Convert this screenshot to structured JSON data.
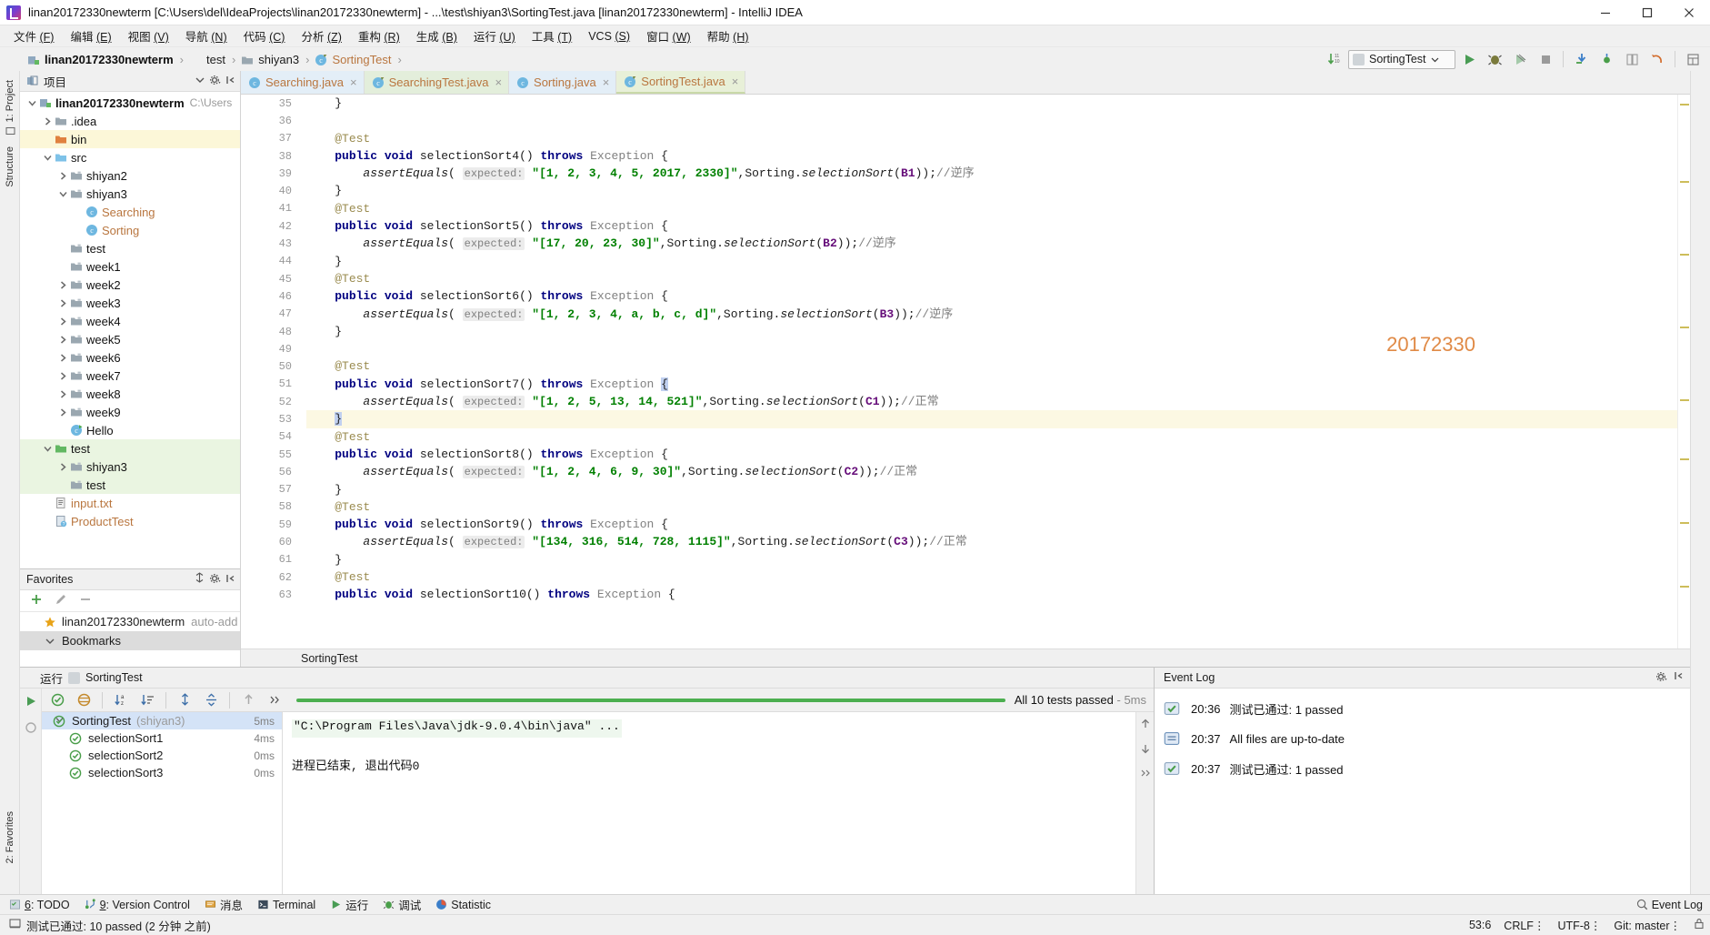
{
  "window": {
    "title": "linan20172330newterm [C:\\Users\\del\\IdeaProjects\\linan20172330newterm] - ...\\test\\shiyan3\\SortingTest.java [linan20172330newterm] - IntelliJ IDEA",
    "minimize_label": "minimize-icon",
    "maximize_label": "maximize-icon",
    "close_label": "close-icon"
  },
  "menubar": {
    "items": [
      {
        "label": "文件 (F)"
      },
      {
        "label": "编辑 (E)"
      },
      {
        "label": "视图 (V)"
      },
      {
        "label": "导航 (N)"
      },
      {
        "label": "代码 (C)"
      },
      {
        "label": "分析 (Z)"
      },
      {
        "label": "重构 (R)"
      },
      {
        "label": "生成 (B)"
      },
      {
        "label": "运行 (U)"
      },
      {
        "label": "工具 (T)"
      },
      {
        "label": "VCS (S)"
      },
      {
        "label": "窗口 (W)"
      },
      {
        "label": "帮助 (H)"
      }
    ]
  },
  "navbar": {
    "breadcrumbs": [
      {
        "label": "linan20172330newterm",
        "icon": "module-icon",
        "style": "bold"
      },
      {
        "label": "test",
        "icon": "source-folder-icon",
        "style": "plain"
      },
      {
        "label": "shiyan3",
        "icon": "folder-icon",
        "style": "plain"
      },
      {
        "label": "SortingTest",
        "icon": "class-test-icon",
        "style": "orange"
      }
    ],
    "run_config": "SortingTest",
    "buttons": [
      {
        "name": "sort-lines-icon"
      },
      {
        "name": "run-icon"
      },
      {
        "name": "debug-icon"
      },
      {
        "name": "run-with-coverage-icon"
      },
      {
        "name": "stop-icon"
      },
      {
        "name": "update-project-icon"
      },
      {
        "name": "commit-icon"
      },
      {
        "name": "compare-icon"
      },
      {
        "name": "rollback-icon"
      },
      {
        "name": "structure-icon"
      }
    ]
  },
  "left_rail": [
    {
      "label": "1: Project",
      "icon": "project-icon"
    },
    {
      "label": "Structure",
      "icon": "structure-icon"
    }
  ],
  "left_rail_bottom": [
    {
      "label": "2: Favorites",
      "icon": "favorites-icon"
    }
  ],
  "project_panel": {
    "header_title": "项目",
    "header_icons": [
      "collapse-icon",
      "gear-icon"
    ],
    "tree": [
      {
        "depth": 0,
        "label": "linan20172330newterm",
        "sub": "C:\\Users",
        "icon": "module-icon",
        "arrow": "down",
        "bold": true,
        "hl": ""
      },
      {
        "depth": 1,
        "label": ".idea",
        "icon": "folder-icon",
        "arrow": "right",
        "bold": false,
        "hl": ""
      },
      {
        "depth": 1,
        "label": "bin",
        "icon": "folder-orange-icon",
        "arrow": "",
        "bold": false,
        "hl": "yellow"
      },
      {
        "depth": 1,
        "label": "src",
        "icon": "folder-blue-icon",
        "arrow": "down",
        "bold": false,
        "hl": ""
      },
      {
        "depth": 2,
        "label": "shiyan2",
        "icon": "package-icon",
        "arrow": "right",
        "bold": false,
        "hl": ""
      },
      {
        "depth": 2,
        "label": "shiyan3",
        "icon": "package-icon",
        "arrow": "down",
        "bold": false,
        "hl": ""
      },
      {
        "depth": 3,
        "label": "Searching",
        "icon": "class-icon",
        "arrow": "",
        "bold": false,
        "hl": "",
        "orange": true
      },
      {
        "depth": 3,
        "label": "Sorting",
        "icon": "class-icon",
        "arrow": "",
        "bold": false,
        "hl": "",
        "orange": true
      },
      {
        "depth": 2,
        "label": "test",
        "icon": "package-icon",
        "arrow": "",
        "bold": false,
        "hl": ""
      },
      {
        "depth": 2,
        "label": "week1",
        "icon": "package-icon",
        "arrow": "",
        "bold": false,
        "hl": ""
      },
      {
        "depth": 2,
        "label": "week2",
        "icon": "package-icon",
        "arrow": "right",
        "bold": false,
        "hl": ""
      },
      {
        "depth": 2,
        "label": "week3",
        "icon": "package-icon",
        "arrow": "right",
        "bold": false,
        "hl": ""
      },
      {
        "depth": 2,
        "label": "week4",
        "icon": "package-icon",
        "arrow": "right",
        "bold": false,
        "hl": ""
      },
      {
        "depth": 2,
        "label": "week5",
        "icon": "package-icon",
        "arrow": "right",
        "bold": false,
        "hl": ""
      },
      {
        "depth": 2,
        "label": "week6",
        "icon": "package-icon",
        "arrow": "right",
        "bold": false,
        "hl": ""
      },
      {
        "depth": 2,
        "label": "week7",
        "icon": "package-icon",
        "arrow": "right",
        "bold": false,
        "hl": ""
      },
      {
        "depth": 2,
        "label": "week8",
        "icon": "package-icon",
        "arrow": "right",
        "bold": false,
        "hl": ""
      },
      {
        "depth": 2,
        "label": "week9",
        "icon": "package-icon",
        "arrow": "right",
        "bold": false,
        "hl": ""
      },
      {
        "depth": 2,
        "label": "Hello",
        "icon": "class-run-icon",
        "arrow": "",
        "bold": false,
        "hl": ""
      },
      {
        "depth": 1,
        "label": "test",
        "icon": "folder-green-icon",
        "arrow": "down",
        "bold": false,
        "hl": "green"
      },
      {
        "depth": 2,
        "label": "shiyan3",
        "icon": "package-icon",
        "arrow": "right",
        "bold": false,
        "hl": "green"
      },
      {
        "depth": 2,
        "label": "test",
        "icon": "package-icon",
        "arrow": "",
        "bold": false,
        "hl": "green"
      },
      {
        "depth": 1,
        "label": "input.txt",
        "icon": "text-file-icon",
        "arrow": "",
        "bold": false,
        "hl": "",
        "orange": true
      },
      {
        "depth": 1,
        "label": "ProductTest",
        "icon": "file-icon",
        "arrow": "",
        "bold": false,
        "hl": "",
        "orange": true
      }
    ]
  },
  "favorites_panel": {
    "title": "Favorites",
    "toolbar_icons": [
      "add-icon",
      "edit-icon",
      "remove-icon"
    ],
    "items": [
      {
        "label": "linan20172330newterm",
        "sub": "auto-add",
        "icon": "star-icon",
        "style": "sel"
      },
      {
        "label": "Bookmarks",
        "sub": "",
        "icon": "chevron-down-icon",
        "style": "grey"
      }
    ]
  },
  "editor": {
    "tabs": [
      {
        "label": "Searching.java",
        "icon": "class-icon",
        "active": false,
        "theme": "t1"
      },
      {
        "label": "SearchingTest.java",
        "icon": "class-test-icon",
        "active": false,
        "theme": "t2"
      },
      {
        "label": "Sorting.java",
        "icon": "class-icon",
        "active": false,
        "theme": "t3"
      },
      {
        "label": "SortingTest.java",
        "icon": "class-test-icon",
        "active": true,
        "theme": "t4"
      }
    ],
    "watermark": "20172330",
    "breadcrumb": "SortingTest",
    "first_line_number": 35,
    "lines": [
      {
        "n": 35,
        "html": "    }",
        "gutter_run": false,
        "fold": true,
        "hl": false
      },
      {
        "n": 36,
        "html": "",
        "gutter_run": false,
        "fold": false,
        "hl": false
      },
      {
        "n": 37,
        "html": "    <span class='ann'>@Test</span>",
        "gutter_run": false,
        "fold": false,
        "hl": false
      },
      {
        "n": 38,
        "html": "    <span class='kw'>public void</span> selectionSort4() <span class='kw'>throws</span> <span class='typ'>Exception</span> {",
        "gutter_run": true,
        "fold": true,
        "hl": false
      },
      {
        "n": 39,
        "html": "        <span class='ital'>assertEquals</span>( <span class='hint'>expected:</span> <span class='str'>\"[1, 2, 3, 4, 5, 2017, 2330]\"</span>,Sorting.<span class='ital'>selectionSort</span>(<span class='fld'>B1</span>));<span class='cmt'>//逆序</span>",
        "gutter_run": false,
        "fold": false,
        "hl": false
      },
      {
        "n": 40,
        "html": "    }",
        "gutter_run": false,
        "fold": true,
        "hl": false
      },
      {
        "n": 41,
        "html": "    <span class='ann'>@Test</span>",
        "gutter_run": false,
        "fold": false,
        "hl": false
      },
      {
        "n": 42,
        "html": "    <span class='kw'>public void</span> selectionSort5() <span class='kw'>throws</span> <span class='typ'>Exception</span> {",
        "gutter_run": true,
        "fold": true,
        "hl": false
      },
      {
        "n": 43,
        "html": "        <span class='ital'>assertEquals</span>( <span class='hint'>expected:</span> <span class='str'>\"[17, 20, 23, 30]\"</span>,Sorting.<span class='ital'>selectionSort</span>(<span class='fld'>B2</span>));<span class='cmt'>//逆序</span>",
        "gutter_run": false,
        "fold": false,
        "hl": false
      },
      {
        "n": 44,
        "html": "    }",
        "gutter_run": false,
        "fold": true,
        "hl": false
      },
      {
        "n": 45,
        "html": "    <span class='ann'>@Test</span>",
        "gutter_run": false,
        "fold": false,
        "hl": false
      },
      {
        "n": 46,
        "html": "    <span class='kw'>public void</span> selectionSort6() <span class='kw'>throws</span> <span class='typ'>Exception</span> {",
        "gutter_run": true,
        "fold": true,
        "hl": false
      },
      {
        "n": 47,
        "html": "        <span class='ital'>assertEquals</span>( <span class='hint'>expected:</span> <span class='str'>\"[1, 2, 3, 4, a, b, c, d]\"</span>,Sorting.<span class='ital'>selectionSort</span>(<span class='fld'>B3</span>));<span class='cmt'>//逆序</span>",
        "gutter_run": false,
        "fold": false,
        "hl": false
      },
      {
        "n": 48,
        "html": "    }",
        "gutter_run": false,
        "fold": true,
        "hl": false
      },
      {
        "n": 49,
        "html": "",
        "gutter_run": false,
        "fold": false,
        "hl": false
      },
      {
        "n": 50,
        "html": "    <span class='ann'>@Test</span>",
        "gutter_run": false,
        "fold": false,
        "hl": false
      },
      {
        "n": 51,
        "html": "    <span class='kw'>public void</span> selectionSort7() <span class='kw'>throws</span> <span class='typ'>Exception</span> <span class='sel'>{</span>",
        "gutter_run": true,
        "fold": true,
        "hl": false
      },
      {
        "n": 52,
        "html": "        <span class='ital'>assertEquals</span>( <span class='hint'>expected:</span> <span class='str'>\"[1, 2, 5, 13, 14, 521]\"</span>,Sorting.<span class='ital'>selectionSort</span>(<span class='fld'>C1</span>));<span class='cmt'>//正常</span>",
        "gutter_run": false,
        "fold": false,
        "hl": false
      },
      {
        "n": 53,
        "html": "    <span class='sel'>}</span>",
        "gutter_run": false,
        "fold": true,
        "hl": true
      },
      {
        "n": 54,
        "html": "    <span class='ann'>@Test</span>",
        "gutter_run": false,
        "fold": false,
        "hl": false
      },
      {
        "n": 55,
        "html": "    <span class='kw'>public void</span> selectionSort8() <span class='kw'>throws</span> <span class='typ'>Exception</span> {",
        "gutter_run": true,
        "fold": true,
        "hl": false
      },
      {
        "n": 56,
        "html": "        <span class='ital'>assertEquals</span>( <span class='hint'>expected:</span> <span class='str'>\"[1, 2, 4, 6, 9, 30]\"</span>,Sorting.<span class='ital'>selectionSort</span>(<span class='fld'>C2</span>));<span class='cmt'>//正常</span>",
        "gutter_run": false,
        "fold": false,
        "hl": false
      },
      {
        "n": 57,
        "html": "    }",
        "gutter_run": false,
        "fold": true,
        "hl": false
      },
      {
        "n": 58,
        "html": "    <span class='ann'>@Test</span>",
        "gutter_run": false,
        "fold": false,
        "hl": false
      },
      {
        "n": 59,
        "html": "    <span class='kw'>public void</span> selectionSort9() <span class='kw'>throws</span> <span class='typ'>Exception</span> {",
        "gutter_run": true,
        "fold": true,
        "hl": false
      },
      {
        "n": 60,
        "html": "        <span class='ital'>assertEquals</span>( <span class='hint'>expected:</span> <span class='str'>\"[134, 316, 514, 728, 1115]\"</span>,Sorting.<span class='ital'>selectionSort</span>(<span class='fld'>C3</span>));<span class='cmt'>//正常</span>",
        "gutter_run": false,
        "fold": false,
        "hl": false
      },
      {
        "n": 61,
        "html": "    }",
        "gutter_run": false,
        "fold": true,
        "hl": false
      },
      {
        "n": 62,
        "html": "    <span class='ann'>@Test</span>",
        "gutter_run": false,
        "fold": false,
        "hl": false
      },
      {
        "n": 63,
        "html": "    <span class='kw'>public void</span> selectionSort10() <span class='kw'>throws</span> <span class='typ'>Exception</span> {",
        "gutter_run": true,
        "fold": true,
        "hl": false
      }
    ]
  },
  "run_panel": {
    "header_label": "运行",
    "header_config": "SortingTest",
    "toolbar_icons": [
      "rerun-icon",
      "show-passed-icon",
      "show-ignored-icon",
      "sort-alpha-icon",
      "sort-duration-icon",
      "expand-all-icon",
      "collapse-all-icon",
      "prev-icon",
      "more-icon"
    ],
    "progress_text": "All 10 tests passed",
    "progress_time": "- 5ms",
    "progress_percent": 100,
    "tests": [
      {
        "label": "SortingTest",
        "sub": "(shiyan3)",
        "time": "5ms",
        "depth": 0,
        "icon": "test-passed-icon",
        "selected": true
      },
      {
        "label": "selectionSort1",
        "sub": "",
        "time": "4ms",
        "depth": 1,
        "icon": "test-passed-icon",
        "selected": false
      },
      {
        "label": "selectionSort2",
        "sub": "",
        "time": "0ms",
        "depth": 1,
        "icon": "test-passed-icon",
        "selected": false
      },
      {
        "label": "selectionSort3",
        "sub": "",
        "time": "0ms",
        "depth": 1,
        "icon": "test-passed-icon",
        "selected": false
      }
    ],
    "console_lines": [
      {
        "text": "\"C:\\Program Files\\Java\\jdk-9.0.4\\bin\\java\" ...",
        "style": "cmd"
      },
      {
        "text": "",
        "style": "plain"
      },
      {
        "text": "进程已结束, 退出代码0",
        "style": "plain"
      }
    ]
  },
  "event_log": {
    "title": "Event Log",
    "header_icons": [
      "gear-icon",
      "collapse-icon"
    ],
    "entries": [
      {
        "time": "20:36",
        "text": "测试已通过: 1 passed",
        "icon": "test-event-icon"
      },
      {
        "time": "20:37",
        "text": "All files are up-to-date",
        "icon": "info-event-icon"
      },
      {
        "time": "20:37",
        "text": "测试已通过: 1 passed",
        "icon": "test-event-icon"
      }
    ]
  },
  "tool_strip": {
    "items": [
      {
        "label": "6: TODO",
        "icon": "todo-icon"
      },
      {
        "label": "9: Version Control",
        "icon": "vcs-icon"
      },
      {
        "label": "消息",
        "icon": "messages-icon"
      },
      {
        "label": "Terminal",
        "icon": "terminal-icon"
      },
      {
        "label": "运行",
        "icon": "run-icon"
      },
      {
        "label": "调试",
        "icon": "debug-icon"
      },
      {
        "label": "Statistic",
        "icon": "statistic-icon"
      }
    ],
    "right_label": "Event Log",
    "right_icon": "event-log-icon"
  },
  "status_bar": {
    "message": "测试已通过: 10 passed (2 分钟 之前)",
    "caret": "53:6",
    "line_sep": "CRLF",
    "encoding": "UTF-8",
    "branch": "Git: master",
    "lock_icon": "lock-icon",
    "msg_icon": "message-icon"
  }
}
